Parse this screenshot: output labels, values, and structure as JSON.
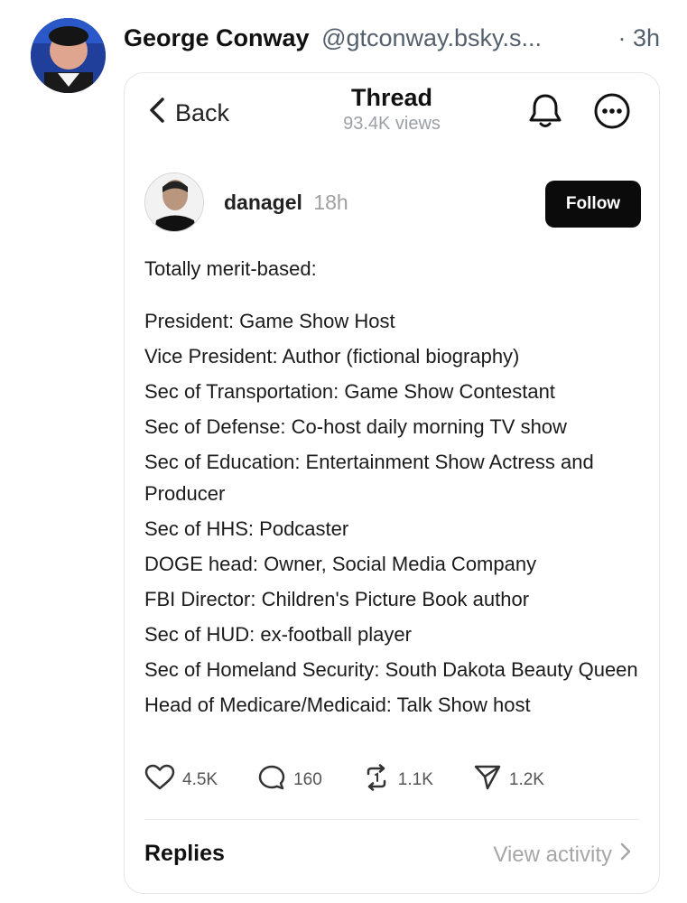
{
  "post": {
    "author_name": "George Conway",
    "author_handle": "@gtconway.bsky.s...",
    "time": "· 3h"
  },
  "thread_view": {
    "back_label": "Back",
    "title": "Thread",
    "views": "93.4K views"
  },
  "quoted_post": {
    "username": "danagel",
    "time": "18h",
    "follow_label": "Follow",
    "intro": "Totally merit-based:",
    "lines": [
      "President: Game Show Host",
      "Vice President: Author (fictional biography)",
      "Sec of Transportation: Game Show Contestant",
      "Sec of Defense: Co-host daily morning TV show",
      "Sec of Education: Entertainment Show Actress and Producer",
      "Sec of HHS: Podcaster",
      "DOGE head: Owner, Social Media Company",
      "FBI Director: Children's Picture Book author",
      "Sec of HUD: ex-football player",
      "Sec of Homeland Security: South Dakota Beauty Queen",
      "Head of Medicare/Medicaid: Talk Show host"
    ],
    "stats": {
      "likes": "4.5K",
      "replies": "160",
      "reposts": "1.1K",
      "shares": "1.2K"
    }
  },
  "footer": {
    "replies_label": "Replies",
    "view_activity_label": "View activity"
  },
  "icons": {
    "back": "chevron-left-icon",
    "bell": "bell-icon",
    "more": "more-icon",
    "like": "heart-icon",
    "reply": "comment-icon",
    "repost": "repost-icon",
    "share": "send-icon",
    "chevron": "chevron-right-icon"
  }
}
